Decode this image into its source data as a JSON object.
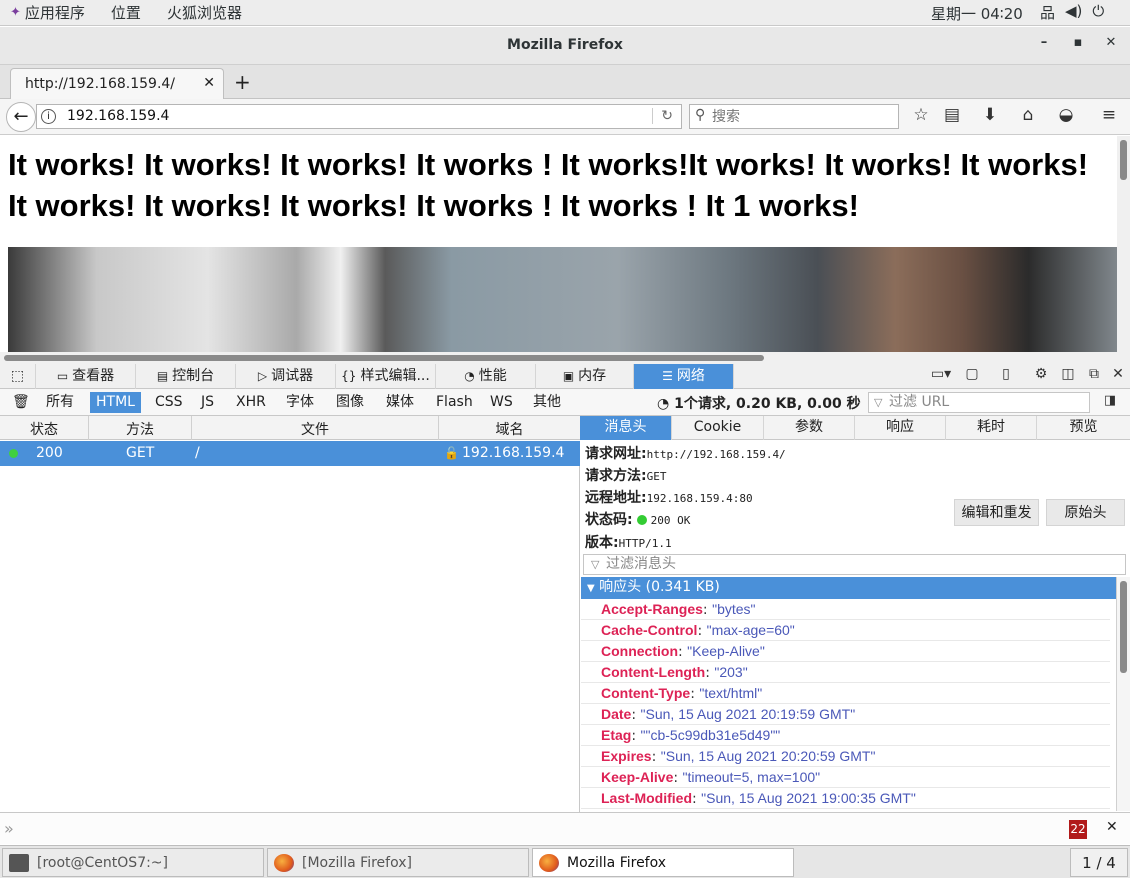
{
  "topbar": {
    "apps_label": "应用程序",
    "places_label": "位置",
    "firefox_label": "火狐浏览器",
    "clock": "星期一 04∶20"
  },
  "window": {
    "title": "Mozilla Firefox"
  },
  "tab": {
    "label": "http://192.168.159.4/"
  },
  "navbar": {
    "url": "192.168.159.4",
    "search_placeholder": "搜索"
  },
  "page": {
    "headline": "It works! It works! It works! It works ! It works!It works! It works! It works! It works! It works! It works! It works ! It works ! It 1 works!"
  },
  "devtools": {
    "tabs": [
      "查看器",
      "控制台",
      "调试器",
      "样式编辑...",
      "性能",
      "内存",
      "网络"
    ],
    "filters": [
      "所有",
      "HTML",
      "CSS",
      "JS",
      "XHR",
      "字体",
      "图像",
      "媒体",
      "Flash",
      "WS",
      "其他"
    ],
    "summary": "1个请求, 0.20 KB, 0.00 秒",
    "url_filter_placeholder": "过滤 URL",
    "columns": [
      "状态",
      "方法",
      "文件",
      "域名"
    ],
    "request": {
      "status": "200",
      "method": "GET",
      "file": "/",
      "domain": "192.168.159.4"
    },
    "detail_tabs": [
      "消息头",
      "Cookie",
      "参数",
      "响应",
      "耗时",
      "预览"
    ],
    "summary_items": {
      "url_label": "请求网址:",
      "url_value": "http://192.168.159.4/",
      "method_label": "请求方法:",
      "method_value": "GET",
      "remote_label": "远程地址:",
      "remote_value": "192.168.159.4:80",
      "status_label": "状态码:",
      "status_value": "200 OK",
      "version_label": "版本:",
      "version_value": "HTTP/1.1"
    },
    "edit_resend": "编辑和重发",
    "raw_headers": "原始头",
    "header_filter_placeholder": "过滤消息头",
    "response_headers_title": "响应头 (0.341 KB)",
    "headers": [
      {
        "name": "Accept-Ranges",
        "value": "\"bytes\""
      },
      {
        "name": "Cache-Control",
        "value": "\"max-age=60\""
      },
      {
        "name": "Connection",
        "value": "\"Keep-Alive\""
      },
      {
        "name": "Content-Length",
        "value": "\"203\""
      },
      {
        "name": "Content-Type",
        "value": "\"text/html\""
      },
      {
        "name": "Date",
        "value": "\"Sun, 15 Aug 2021 20:19:59 GMT\""
      },
      {
        "name": "Etag",
        "value": "\"\"cb-5c99db31e5d49\"\""
      },
      {
        "name": "Expires",
        "value": "\"Sun, 15 Aug 2021 20:20:59 GMT\""
      },
      {
        "name": "Keep-Alive",
        "value": "\"timeout=5, max=100\""
      },
      {
        "name": "Last-Modified",
        "value": "\"Sun, 15 Aug 2021 19:00:35 GMT\""
      }
    ],
    "error_count": "22"
  },
  "taskbar": {
    "terminal": "[root@CentOS7:~]",
    "firefox_bracket": "[Mozilla Firefox]",
    "firefox_active": "Mozilla Firefox",
    "pager": "1 / 4"
  },
  "colors": {
    "accent": "#4a90d9",
    "header_name": "#dd2255",
    "header_value": "#4a58b8"
  }
}
